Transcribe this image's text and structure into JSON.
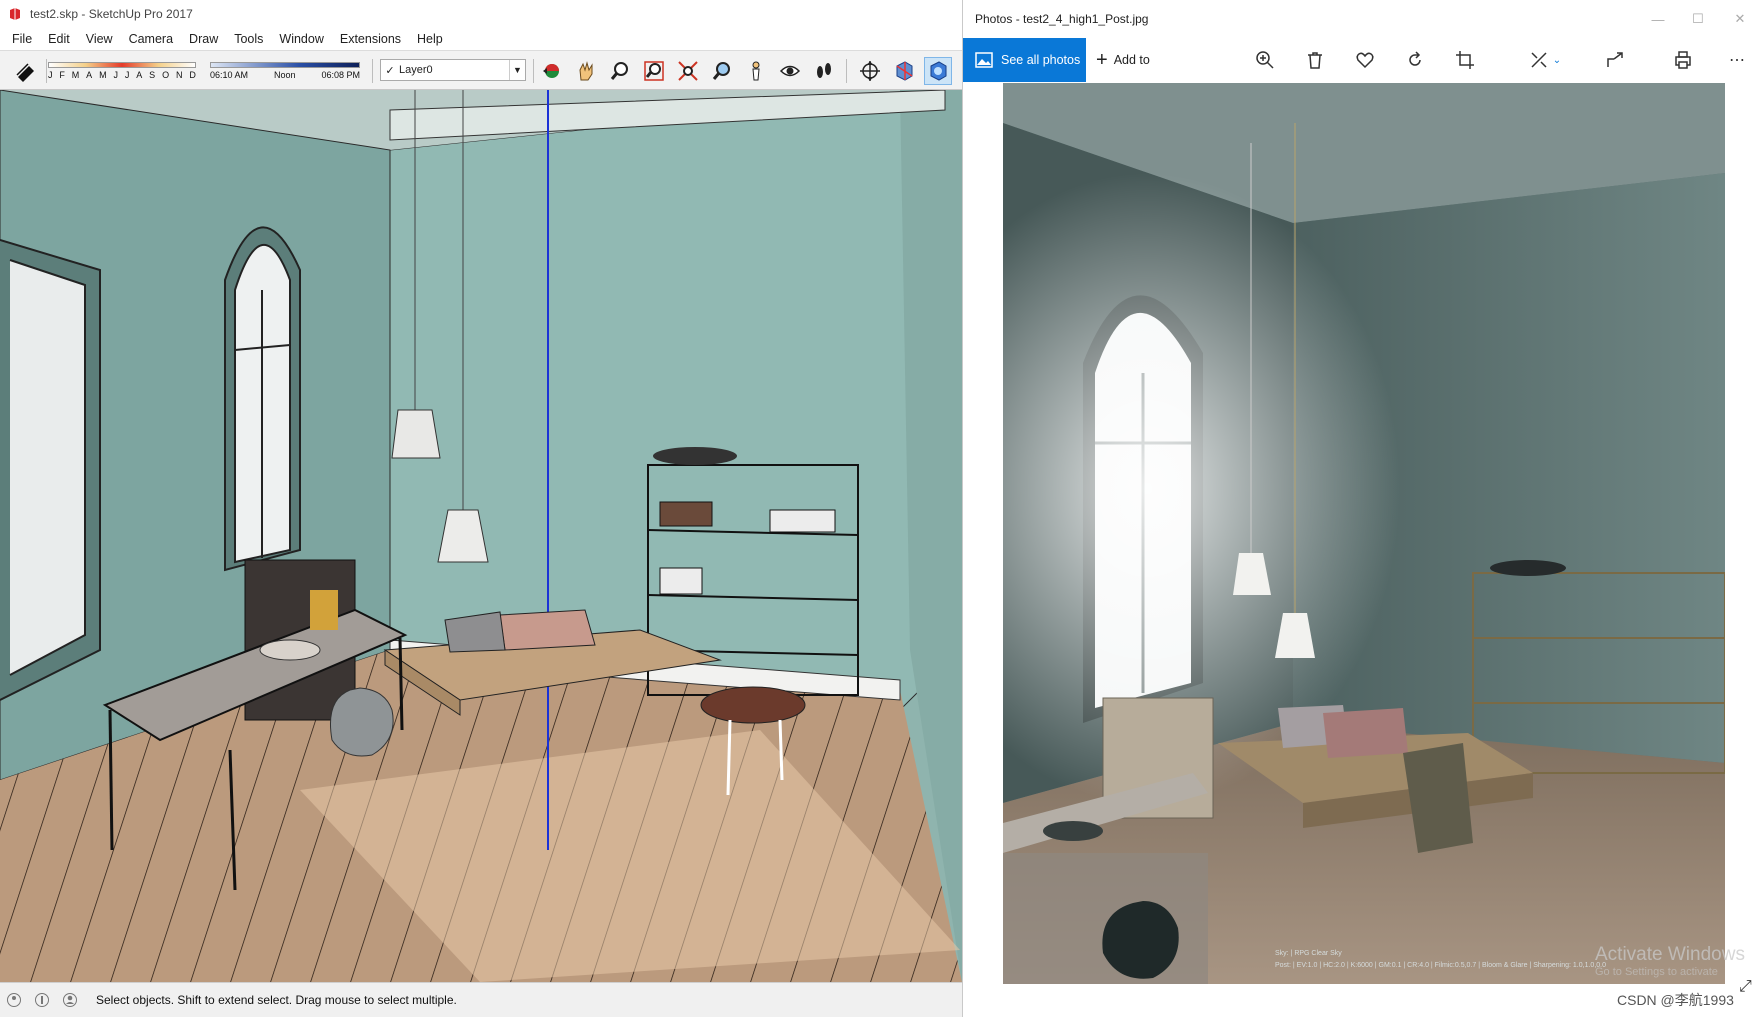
{
  "sketchup": {
    "title": "test2.skp - SketchUp Pro 2017",
    "menu": [
      "File",
      "Edit",
      "View",
      "Camera",
      "Draw",
      "Tools",
      "Window",
      "Extensions",
      "Help"
    ],
    "shadow": {
      "months": [
        "J",
        "F",
        "M",
        "A",
        "M",
        "J",
        "J",
        "A",
        "S",
        "O",
        "N",
        "D"
      ],
      "time_start": "06:10 AM",
      "time_mid": "Noon",
      "time_end": "06:08 PM"
    },
    "layer": "Layer0",
    "tools": [
      "orbit-icon",
      "pan-icon",
      "zoom-icon",
      "zoom-window-icon",
      "zoom-extents-icon",
      "previous-view-icon",
      "position-camera-icon",
      "look-around-icon",
      "walk-icon",
      "section-plane-icon",
      "display-section-icon",
      "style-icon"
    ],
    "status_text": "Select objects. Shift to extend select. Drag mouse to select multiple."
  },
  "photos": {
    "title": "Photos - test2_4_high1_Post.jpg",
    "see_all": "See all photos",
    "add_to": "Add to",
    "toolbar_icons": [
      "zoom-in-icon",
      "delete-icon",
      "favorite-icon",
      "rotate-icon",
      "crop-icon",
      "edit-icon",
      "share-icon",
      "print-icon",
      "more-icon"
    ],
    "meta_line1": "Sky: | RPG Clear Sky",
    "meta_line2": "Post: | EV:1.0 | HC:2.0 | K:6000 | GM:0.1 | CR:4.0 | Filmic:0.5,0.7 | Bloom & Glare | Sharpening: 1.0,1.0,0.0"
  },
  "overlay": {
    "activate_line1": "Activate Windows",
    "activate_line2": "Go to Settings to activate",
    "csdn": "CSDN @李航1993"
  },
  "colors": {
    "accent": "#0a78d7",
    "wall": "#8fb4ae",
    "floor": "#b9977a"
  }
}
